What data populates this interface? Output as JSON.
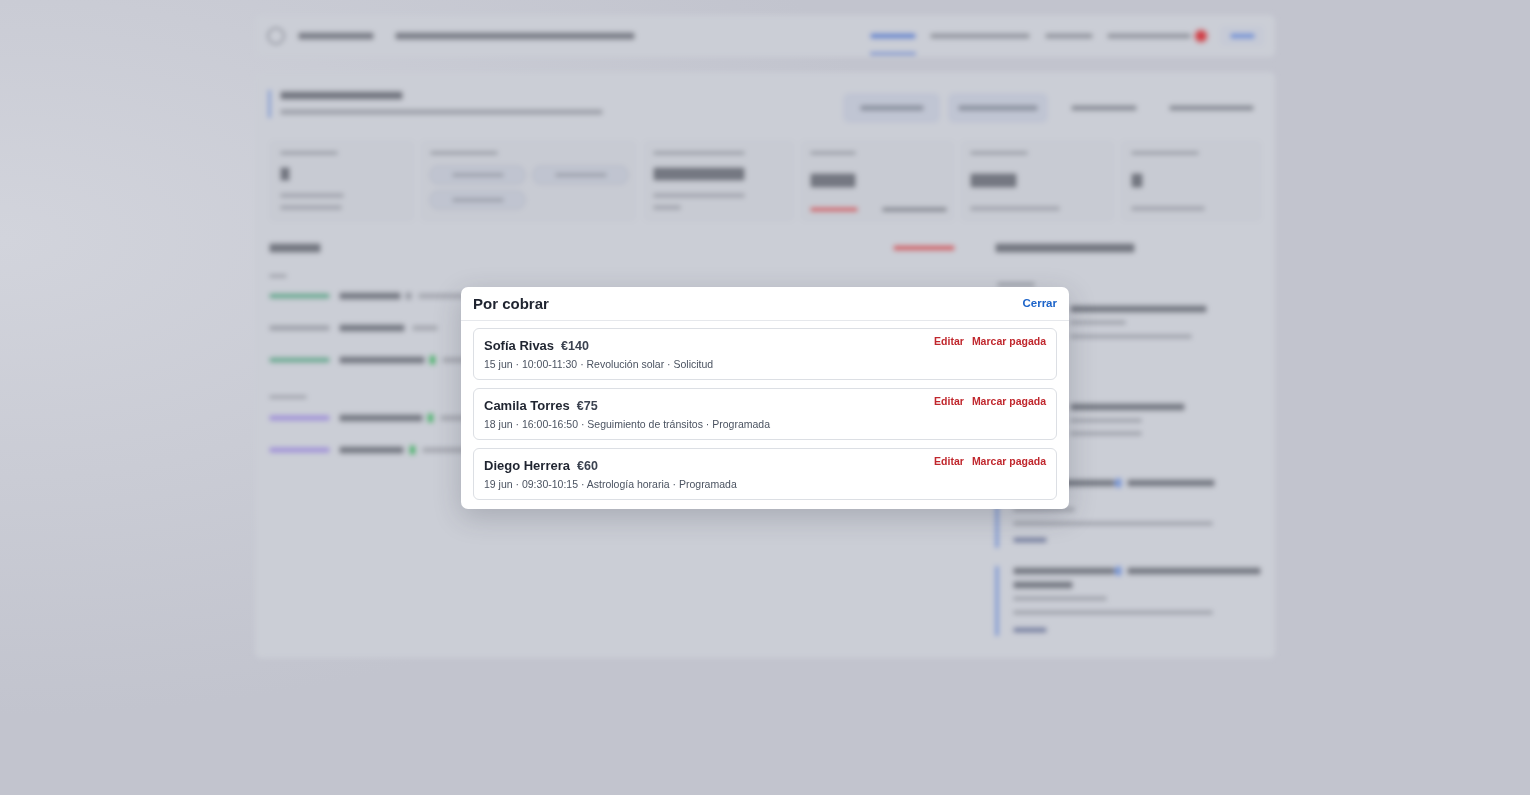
{
  "dialog": {
    "title": "Por cobrar",
    "close_label": "Cerrar",
    "items": [
      {
        "client": "Sofía Rivas",
        "amount": "€140",
        "details": "15 jun · 10:00-11:30 · Revolución solar · Solicitud",
        "actions": [
          "Editar",
          "Marcar pagada"
        ]
      },
      {
        "client": "Camila Torres",
        "amount": "€75",
        "details": "18 jun · 16:00-16:50 · Seguimiento de tránsitos · Programada",
        "actions": [
          "Editar",
          "Marcar pagada"
        ]
      },
      {
        "client": "Diego Herrera",
        "amount": "€60",
        "details": "19 jun · 09:30-10:15 · Astrología horaria · Programada",
        "actions": [
          "Editar",
          "Marcar pagada"
        ]
      }
    ]
  }
}
